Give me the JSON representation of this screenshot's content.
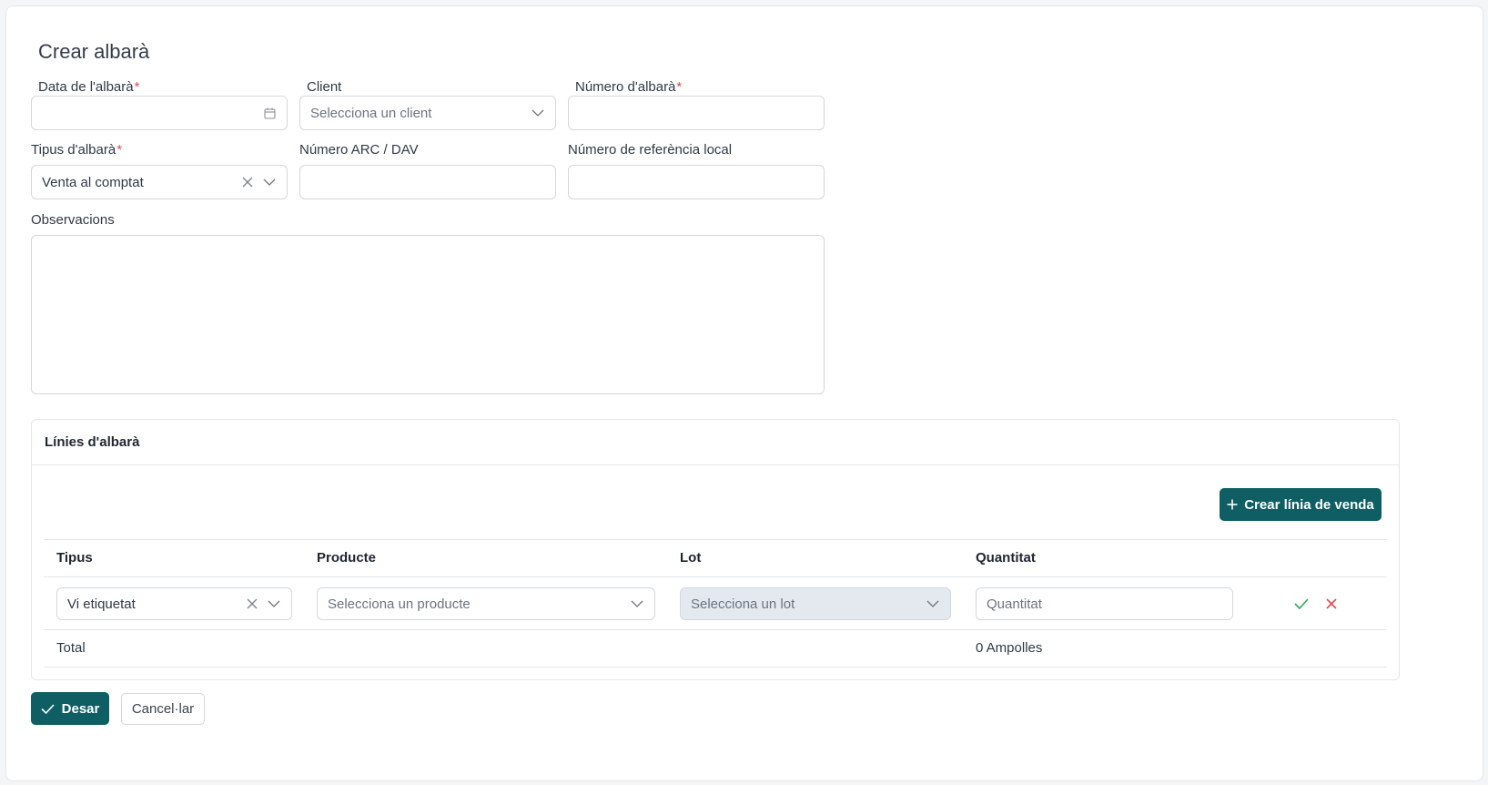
{
  "page": {
    "title": "Crear albarà"
  },
  "form": {
    "date": {
      "label": "Data de l'albarà",
      "required_mark": "*",
      "value": ""
    },
    "client": {
      "label": "Client",
      "placeholder": "Selecciona un client"
    },
    "number": {
      "label": "Número d'albarà",
      "required_mark": "*",
      "value": ""
    },
    "type": {
      "label": "Tipus d'albarà",
      "required_mark": "*",
      "value": "Venta al comptat"
    },
    "arc": {
      "label": "Número ARC / DAV",
      "value": ""
    },
    "local_ref": {
      "label": "Número de referència local",
      "value": ""
    },
    "notes": {
      "label": "Observacions",
      "value": ""
    }
  },
  "lines": {
    "title": "Línies d'albarà",
    "create_button": "Crear línia de venda",
    "columns": [
      "Tipus",
      "Producte",
      "Lot",
      "Quantitat"
    ],
    "row": {
      "type_value": "Vi etiquetat",
      "product_placeholder": "Selecciona un producte",
      "lot_placeholder": "Selecciona un lot",
      "quantity_placeholder": "Quantitat"
    },
    "total": {
      "label": "Total",
      "value": "0 Ampolles"
    }
  },
  "actions": {
    "save": "Desar",
    "cancel": "Cancel·lar"
  },
  "colors": {
    "primary": "#0e5e63",
    "required": "#e5484d",
    "confirm": "#2fa84f",
    "delete": "#e5484d",
    "disabled_bg": "#e4e9f0"
  }
}
